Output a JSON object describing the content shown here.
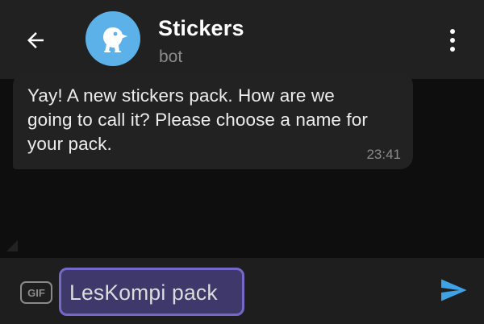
{
  "header": {
    "title": "Stickers",
    "subtitle": "bot",
    "back_icon": "arrow-left-icon",
    "menu_icon": "more-vertical-icon",
    "avatar_color": "#5db1e9"
  },
  "messages": [
    {
      "text": "Yay! A new stickers pack. How are we going to call it? Please choose a name for your pack.",
      "time": "23:41"
    }
  ],
  "composer": {
    "gif_label": "GIF",
    "value": "LesKompi pack",
    "send_icon": "send-icon",
    "highlight_color": "#7468c8",
    "send_color": "#3ea2e6"
  }
}
